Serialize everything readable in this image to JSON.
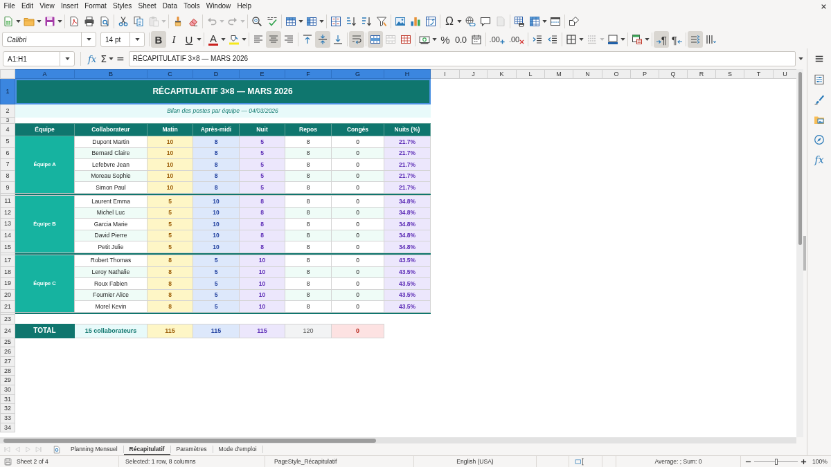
{
  "menu_bar": {
    "items": [
      "File",
      "Edit",
      "View",
      "Insert",
      "Format",
      "Styles",
      "Sheet",
      "Data",
      "Tools",
      "Window",
      "Help"
    ]
  },
  "standard_toolbar": {
    "groups": [
      [
        {
          "kind": "new",
          "disabled": false
        },
        {
          "kind": "open",
          "disabled": false
        },
        {
          "kind": "save",
          "disabled": false
        }
      ],
      [
        {
          "kind": "export_pdf",
          "disabled": false
        },
        {
          "kind": "print",
          "disabled": false
        },
        {
          "kind": "print_preview",
          "disabled": false
        }
      ],
      [
        {
          "kind": "cut",
          "disabled": false
        },
        {
          "kind": "copy",
          "disabled": false
        },
        {
          "kind": "paste",
          "disabled": true
        }
      ],
      [
        {
          "kind": "clone_formatting",
          "disabled": false
        },
        {
          "kind": "clear_formatting",
          "disabled": false
        }
      ],
      [
        {
          "kind": "undo",
          "disabled": true
        },
        {
          "kind": "redo",
          "disabled": true
        }
      ],
      [
        {
          "kind": "find_replace",
          "disabled": false
        },
        {
          "kind": "spelling",
          "disabled": false
        }
      ],
      [
        {
          "kind": "rows",
          "disabled": false
        },
        {
          "kind": "columns",
          "disabled": false
        }
      ],
      [
        {
          "kind": "sort",
          "disabled": false
        },
        {
          "kind": "sort_ascending",
          "disabled": false
        },
        {
          "kind": "sort_descending",
          "disabled": false
        },
        {
          "kind": "autofilter",
          "disabled": false
        }
      ],
      [
        {
          "kind": "image",
          "disabled": false
        },
        {
          "kind": "chart",
          "disabled": false
        },
        {
          "kind": "pivot_table",
          "disabled": false
        }
      ],
      [
        {
          "kind": "special_character",
          "label": "Ω",
          "disabled": false
        },
        {
          "kind": "hyperlink",
          "disabled": false
        },
        {
          "kind": "comment",
          "disabled": false
        },
        {
          "kind": "header_footer",
          "disabled": true
        }
      ],
      [
        {
          "kind": "print_area",
          "disabled": false
        },
        {
          "kind": "freeze",
          "disabled": false
        },
        {
          "kind": "split_window",
          "disabled": false
        }
      ],
      [
        {
          "kind": "draw_functions",
          "disabled": false
        }
      ]
    ]
  },
  "formatting_toolbar": {
    "font_name": "Calibri",
    "font_size": "14 pt",
    "groups": [
      [
        {
          "kind": "bold",
          "label": "B",
          "on": true,
          "disabled": false
        },
        {
          "kind": "italic",
          "label": "I",
          "on": false,
          "disabled": false
        },
        {
          "kind": "underline",
          "label": "U",
          "on": false,
          "disabled": false
        }
      ],
      [
        {
          "kind": "font_color",
          "label": "A",
          "on": false,
          "disabled": false
        },
        {
          "kind": "highlight",
          "on": false,
          "disabled": false
        }
      ],
      [
        {
          "kind": "align_left",
          "on": false,
          "disabled": false
        },
        {
          "kind": "align_center",
          "on": true,
          "disabled": false
        },
        {
          "kind": "align_right",
          "on": false,
          "disabled": false
        }
      ],
      [
        {
          "kind": "align_top",
          "on": false,
          "disabled": false
        },
        {
          "kind": "align_middle",
          "on": true,
          "disabled": false
        },
        {
          "kind": "align_bottom",
          "on": false,
          "disabled": false
        }
      ],
      [
        {
          "kind": "wrap",
          "on": true,
          "disabled": false
        }
      ],
      [
        {
          "kind": "merge_center",
          "on": true,
          "disabled": false
        },
        {
          "kind": "merge",
          "on": false,
          "disabled": true
        },
        {
          "kind": "unmerge",
          "on": false,
          "disabled": false
        }
      ],
      [
        {
          "kind": "number_format",
          "on": false,
          "disabled": false
        },
        {
          "kind": "percent",
          "label": "%",
          "on": false,
          "disabled": false
        },
        {
          "kind": "decimal_format",
          "label": "0.0",
          "on": false,
          "disabled": false
        },
        {
          "kind": "date_format",
          "on": false,
          "disabled": false
        }
      ],
      [
        {
          "kind": "add_decimal",
          "label": ".00",
          "on": false,
          "disabled": false
        },
        {
          "kind": "delete_decimal",
          "label": ".00",
          "on": false,
          "disabled": false
        }
      ],
      [
        {
          "kind": "indent_more",
          "on": false,
          "disabled": false
        },
        {
          "kind": "indent_less",
          "on": false,
          "disabled": false
        }
      ],
      [
        {
          "kind": "borders",
          "on": false,
          "disabled": false
        },
        {
          "kind": "border_style",
          "on": false,
          "disabled": true
        },
        {
          "kind": "border_color",
          "on": false,
          "disabled": false
        }
      ],
      [
        {
          "kind": "conditional",
          "on": false,
          "disabled": false
        }
      ],
      [
        {
          "kind": "ltr",
          "label": "¶",
          "on": true,
          "disabled": false
        },
        {
          "kind": "rtl",
          "label": "¶",
          "on": false,
          "disabled": false
        }
      ],
      [
        {
          "kind": "text_lr",
          "on": true,
          "disabled": false
        },
        {
          "kind": "text_tb",
          "on": false,
          "disabled": false
        }
      ]
    ]
  },
  "formula_bar": {
    "name_box": "A1:H1",
    "wizard": "fx",
    "sum": "Σ",
    "equals": "=",
    "content": "RÉCAPITULATIF 3×8 — MARS 2026"
  },
  "sidebar": {
    "decks": [
      {
        "kind": "properties"
      },
      {
        "kind": "styles"
      },
      {
        "kind": "gallery"
      },
      {
        "kind": "navigator"
      },
      {
        "kind": "functions",
        "label": "fx"
      }
    ]
  },
  "sheet": {
    "columns": [
      {
        "label": "A",
        "selected": true
      },
      {
        "label": "B",
        "selected": true
      },
      {
        "label": "C",
        "selected": true
      },
      {
        "label": "D",
        "selected": true
      },
      {
        "label": "E",
        "selected": true
      },
      {
        "label": "F",
        "selected": true
      },
      {
        "label": "G",
        "selected": true
      },
      {
        "label": "H",
        "selected": true
      },
      {
        "label": "I",
        "selected": false
      },
      {
        "label": "J",
        "selected": false
      },
      {
        "label": "K",
        "selected": false
      },
      {
        "label": "L",
        "selected": false
      },
      {
        "label": "M",
        "selected": false
      },
      {
        "label": "N",
        "selected": false
      },
      {
        "label": "O",
        "selected": false
      },
      {
        "label": "P",
        "selected": false
      },
      {
        "label": "Q",
        "selected": false
      },
      {
        "label": "R",
        "selected": false
      },
      {
        "label": "S",
        "selected": false
      },
      {
        "label": "T",
        "selected": false
      },
      {
        "label": "U",
        "selected": false
      }
    ],
    "rows": [
      {
        "kind": "title",
        "number": "1",
        "selected": true,
        "text": "RÉCAPITULATIF 3×8 — MARS 2026"
      },
      {
        "kind": "subtitle",
        "number": "2",
        "selected": false,
        "text": "Bilan des postes par équipe — 04/03/2026"
      },
      {
        "kind": "spacer",
        "number": "3",
        "selected": false
      },
      {
        "kind": "header",
        "number": "4",
        "selected": false,
        "cells": [
          "Équipe",
          "Collaborateur",
          "Matin",
          "Après-midi",
          "Nuit",
          "Repos",
          "Congés",
          "Nuits (%)"
        ]
      },
      {
        "kind": "team",
        "team": "Équipe A",
        "members": [
          {
            "number": "5",
            "selected": false,
            "cells": [
              "Dupont Martin",
              "10",
              "8",
              "5",
              "8",
              "0",
              "21.7%"
            ]
          },
          {
            "number": "6",
            "selected": false,
            "cells": [
              "Bernard Claire",
              "10",
              "8",
              "5",
              "8",
              "0",
              "21.7%"
            ]
          },
          {
            "number": "7",
            "selected": false,
            "cells": [
              "Lefebvre Jean",
              "10",
              "8",
              "5",
              "8",
              "0",
              "21.7%"
            ]
          },
          {
            "number": "8",
            "selected": false,
            "cells": [
              "Moreau Sophie",
              "10",
              "8",
              "5",
              "8",
              "0",
              "21.7%"
            ]
          },
          {
            "number": "9",
            "selected": false,
            "cells": [
              "Simon Paul",
              "10",
              "8",
              "5",
              "8",
              "0",
              "21.7%"
            ]
          }
        ]
      },
      {
        "kind": "separator"
      },
      {
        "kind": "team",
        "team": "Équipe B",
        "members": [
          {
            "number": "11",
            "selected": false,
            "cells": [
              "Laurent Emma",
              "5",
              "10",
              "8",
              "8",
              "0",
              "34.8%"
            ]
          },
          {
            "number": "12",
            "selected": false,
            "cells": [
              "Michel Luc",
              "5",
              "10",
              "8",
              "8",
              "0",
              "34.8%"
            ]
          },
          {
            "number": "13",
            "selected": false,
            "cells": [
              "Garcia Marie",
              "5",
              "10",
              "8",
              "8",
              "0",
              "34.8%"
            ]
          },
          {
            "number": "14",
            "selected": false,
            "cells": [
              "David Pierre",
              "5",
              "10",
              "8",
              "8",
              "0",
              "34.8%"
            ]
          },
          {
            "number": "15",
            "selected": false,
            "cells": [
              "Petit Julie",
              "5",
              "10",
              "8",
              "8",
              "0",
              "34.8%"
            ]
          }
        ]
      },
      {
        "kind": "separator"
      },
      {
        "kind": "team",
        "team": "Équipe C",
        "members": [
          {
            "number": "17",
            "selected": false,
            "cells": [
              "Robert Thomas",
              "8",
              "5",
              "10",
              "8",
              "0",
              "43.5%"
            ]
          },
          {
            "number": "18",
            "selected": false,
            "cells": [
              "Leroy Nathalie",
              "8",
              "5",
              "10",
              "8",
              "0",
              "43.5%"
            ]
          },
          {
            "number": "19",
            "selected": false,
            "cells": [
              "Roux Fabien",
              "8",
              "5",
              "10",
              "8",
              "0",
              "43.5%"
            ]
          },
          {
            "number": "20",
            "selected": false,
            "cells": [
              "Fournier Alice",
              "8",
              "5",
              "10",
              "8",
              "0",
              "43.5%"
            ]
          },
          {
            "number": "21",
            "selected": false,
            "cells": [
              "Morel Kevin",
              "8",
              "5",
              "10",
              "8",
              "0",
              "43.5%"
            ]
          }
        ]
      },
      {
        "kind": "separator"
      },
      {
        "kind": "blank",
        "number": "23",
        "selected": false
      },
      {
        "kind": "total",
        "number": "24",
        "selected": false,
        "cells": [
          "TOTAL",
          "15 collaborateurs",
          "115",
          "115",
          "115",
          "120",
          "0"
        ]
      },
      {
        "kind": "blank",
        "number": "25",
        "selected": false
      },
      {
        "kind": "blank",
        "number": "26",
        "selected": false
      },
      {
        "kind": "blank",
        "number": "27",
        "selected": false
      },
      {
        "kind": "blank",
        "number": "28",
        "selected": false
      },
      {
        "kind": "blank",
        "number": "29",
        "selected": false
      },
      {
        "kind": "blank",
        "number": "30",
        "selected": false
      },
      {
        "kind": "blank",
        "number": "31",
        "selected": false
      },
      {
        "kind": "blank",
        "number": "32",
        "selected": false
      },
      {
        "kind": "blank",
        "number": "33",
        "selected": false
      },
      {
        "kind": "blank",
        "number": "34",
        "selected": false
      }
    ]
  },
  "sheet_tabs": {
    "nav_disabled": true,
    "tabs": [
      {
        "label": "Planning Mensuel",
        "selected": false
      },
      {
        "label": "Récapitulatif",
        "selected": true
      },
      {
        "label": "Paramètres",
        "selected": false
      },
      {
        "label": "Mode d'emploi",
        "selected": false
      }
    ]
  },
  "status_bar": {
    "sheet": "Sheet 2 of 4",
    "selection": "Selected: 1 row, 8 columns",
    "page_style": "PageStyle_Récapitulatif",
    "language": "English (USA)",
    "summary": "Average: ; Sum: 0",
    "zoom": {
      "level": 0.5,
      "reading": "100%"
    }
  }
}
